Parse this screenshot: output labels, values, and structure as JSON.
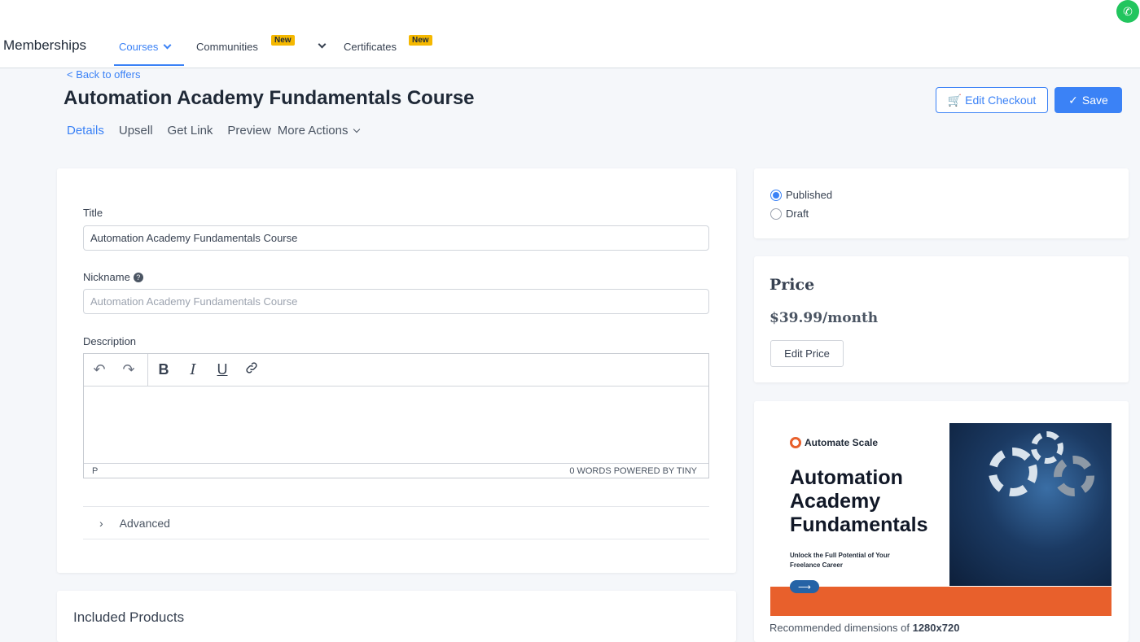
{
  "nav": {
    "brand": "Memberships",
    "items": [
      {
        "label": "Courses",
        "active": true
      },
      {
        "label": "Communities",
        "badge": "New"
      },
      {
        "label": "Certificates",
        "badge": "New"
      }
    ]
  },
  "header": {
    "back_link": "< Back to offers",
    "title": "Automation Academy Fundamentals Course",
    "tabs": [
      "Details",
      "Upsell",
      "Get Link",
      "Preview",
      "More Actions"
    ],
    "edit_checkout_label": "Edit Checkout",
    "save_label": "Save"
  },
  "form": {
    "title_label": "Title",
    "title_value": "Automation Academy Fundamentals Course",
    "nickname_label": "Nickname",
    "nickname_placeholder": "Automation Academy Fundamentals Course",
    "description_label": "Description",
    "editor": {
      "toolbar": [
        "undo",
        "redo",
        "B",
        "I",
        "U",
        "link"
      ],
      "status_left": "P",
      "status_right": "0 WORDS  POWERED BY TINY"
    },
    "advanced_label": "Advanced"
  },
  "status": {
    "options": [
      {
        "label": "Published",
        "checked": true
      },
      {
        "label": "Draft",
        "checked": false
      }
    ]
  },
  "price": {
    "title": "Price",
    "value": "$39.99/month",
    "edit_label": "Edit Price"
  },
  "banner": {
    "logo_text": "Automate Scale",
    "heading": "Automation Academy Fundamentals",
    "subheading": "Unlock the Full Potential of Your Freelance Career",
    "arrow": "⟶",
    "recommended_prefix": "Recommended dimensions of ",
    "recommended_size": "1280x720"
  },
  "included_products_label": "Included Products",
  "colors": {
    "accent": "#3b82f6",
    "badge": "#f5b800",
    "banner_stripe": "#e8602c"
  }
}
